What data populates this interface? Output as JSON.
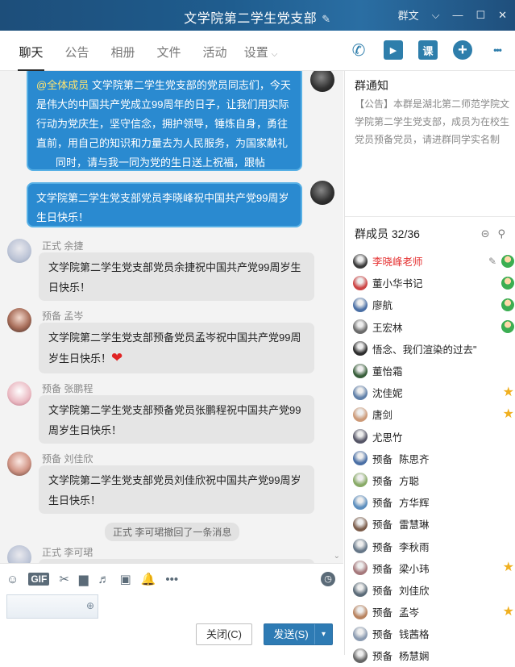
{
  "window": {
    "title": "文学院第二学生党支部",
    "edit_icon": "✎",
    "controls": [
      "…",
      "⌵",
      "—",
      "☐",
      "✕"
    ],
    "corner_label": "群文"
  },
  "tabs": [
    {
      "label": "聊天",
      "active": true
    },
    {
      "label": "公告",
      "active": false
    },
    {
      "label": "相册",
      "active": false
    },
    {
      "label": "文件",
      "active": false
    },
    {
      "label": "活动",
      "active": false
    },
    {
      "label": "设置",
      "active": false
    }
  ],
  "toolbar": {
    "voice_call": "✆",
    "video_call": "▶",
    "course": "课",
    "add": "+",
    "more": "•••"
  },
  "messages": [
    {
      "type": "self",
      "mention": "@全体成员",
      "text": " 文学院第二学生党支部的党员同志们，今天是伟大的中国共产党成立99周年的日子，让我们用实际行动为党庆生，坚守信念，拥护领导，锤炼自身，勇往直前，用自己的知识和力量去为人民服务，为国家献礼",
      "text2": "同时，请与我一同为党的生日送上祝福，跟帖"
    },
    {
      "type": "self",
      "text": "文学院第二学生党支部党员李晓峰祝中国共产党99周岁生日快乐！"
    },
    {
      "type": "other",
      "sender": "正式 余捷",
      "text": "文学院第二学生党支部党员余捷祝中国共产党99周岁生日快乐！"
    },
    {
      "type": "other",
      "sender": "预备 孟岑",
      "text": "文学院第二学生党支部预备党员孟岑祝中国共产党99周岁生日快乐！",
      "emoji": "❤"
    },
    {
      "type": "other",
      "sender": "预备 张鹏程",
      "text": "文学院第二学生党支部预备党员张鹏程祝中国共产党99周岁生日快乐！"
    },
    {
      "type": "other",
      "sender": "预备 刘佳欣",
      "text": "文学院第二学生党支部党员刘佳欣祝中国共产党99周岁生日快乐！"
    },
    {
      "type": "system",
      "text": "正式 李可珺撤回了一条消息"
    },
    {
      "type": "other",
      "sender": "正式 李可珺",
      "text": ""
    }
  ],
  "input": {
    "tools": [
      "☺",
      "GIF",
      "✂",
      "▆",
      "♬",
      "▣",
      "🔔",
      "•••"
    ],
    "history_icon": "◷",
    "close_label": "关闭(C)",
    "send_label": "发送(S)",
    "send_dropdown": "▾"
  },
  "notice": {
    "title": "群通知",
    "body": "【公告】本群是湖北第二师范学院文学院第二学生党支部，成员为在校生党员预备党员，请进群同学实名制"
  },
  "members": {
    "header": "群成员 32/36",
    "list": [
      {
        "name": "李晓峰老师",
        "tag": "",
        "highlight": true,
        "badge": "green",
        "edit": true
      },
      {
        "name": "董小华书记",
        "tag": "",
        "highlight": false,
        "badge": "green"
      },
      {
        "name": "廖航",
        "tag": "",
        "highlight": false,
        "badge": "green"
      },
      {
        "name": "王宏林",
        "tag": "",
        "highlight": false,
        "badge": "green"
      },
      {
        "name": "悟念、我们渲染的过去\"",
        "tag": "",
        "highlight": false,
        "badge": ""
      },
      {
        "name": "董怡霜",
        "tag": "",
        "highlight": false,
        "badge": ""
      },
      {
        "name": "沈佳妮",
        "tag": "",
        "highlight": false,
        "badge": "star"
      },
      {
        "name": "唐剑",
        "tag": "",
        "highlight": false,
        "badge": "star"
      },
      {
        "name": "尤思竹",
        "tag": "",
        "highlight": false,
        "badge": ""
      },
      {
        "name": "陈思齐",
        "tag": "预备",
        "highlight": false,
        "badge": ""
      },
      {
        "name": "方聪",
        "tag": "预备",
        "highlight": false,
        "badge": ""
      },
      {
        "name": "方华辉",
        "tag": "预备",
        "highlight": false,
        "badge": ""
      },
      {
        "name": "雷慧琳",
        "tag": "预备",
        "highlight": false,
        "badge": ""
      },
      {
        "name": "李秋雨",
        "tag": "预备",
        "highlight": false,
        "badge": ""
      },
      {
        "name": "梁小玮",
        "tag": "预备",
        "highlight": false,
        "badge": "star"
      },
      {
        "name": "刘佳欣",
        "tag": "预备",
        "highlight": false,
        "badge": ""
      },
      {
        "name": "孟岑",
        "tag": "预备",
        "highlight": false,
        "badge": "star"
      },
      {
        "name": "钱茜格",
        "tag": "预备",
        "highlight": false,
        "badge": ""
      },
      {
        "name": "杨慧娴",
        "tag": "预备",
        "highlight": false,
        "badge": ""
      }
    ]
  }
}
